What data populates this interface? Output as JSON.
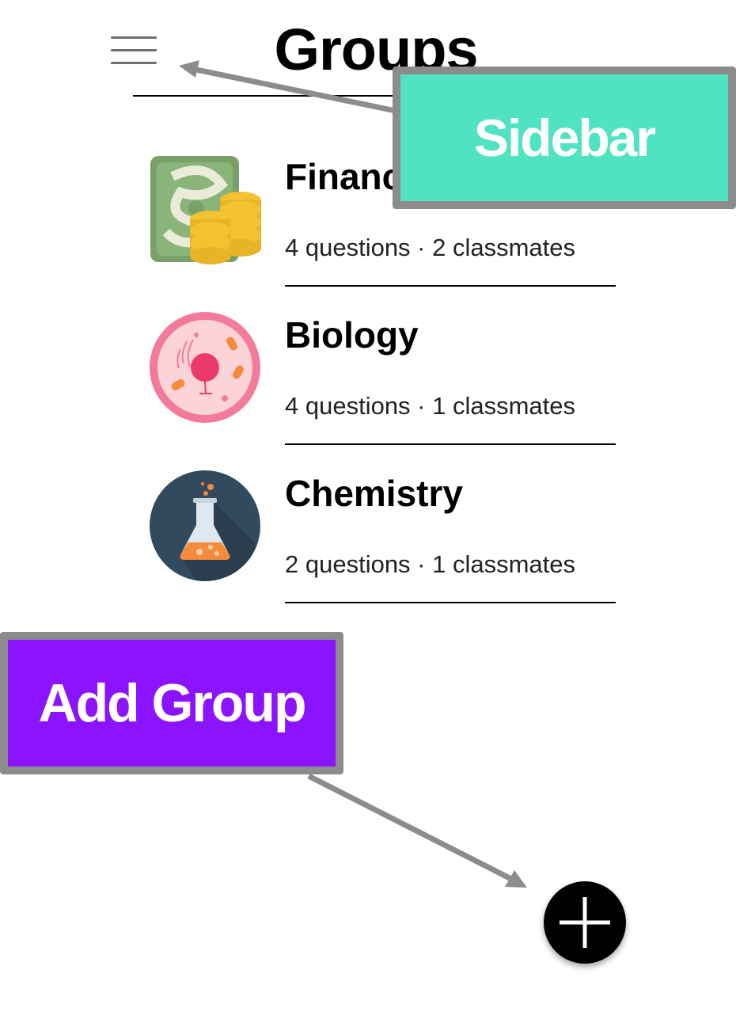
{
  "header": {
    "title": "Groups",
    "menu_icon": "hamburger-menu-icon"
  },
  "groups": [
    {
      "name": "Finance",
      "questions": "4 questions · 2 classmates",
      "icon": "money-coins-icon"
    },
    {
      "name": "Biology",
      "questions": "4 questions · 1 classmates",
      "icon": "cell-icon"
    },
    {
      "name": "Chemistry",
      "questions": "2 questions · 1 classmates",
      "icon": "flask-icon"
    }
  ],
  "annotations": {
    "sidebar": {
      "label": "Sidebar",
      "color": "#50e3c2"
    },
    "add_group": {
      "label": "Add Group",
      "color": "#8c13ff"
    }
  },
  "fab": {
    "icon": "plus-icon"
  },
  "colors": {
    "annotation_border": "#8c8c8c",
    "arrow": "#8c8c8c"
  }
}
